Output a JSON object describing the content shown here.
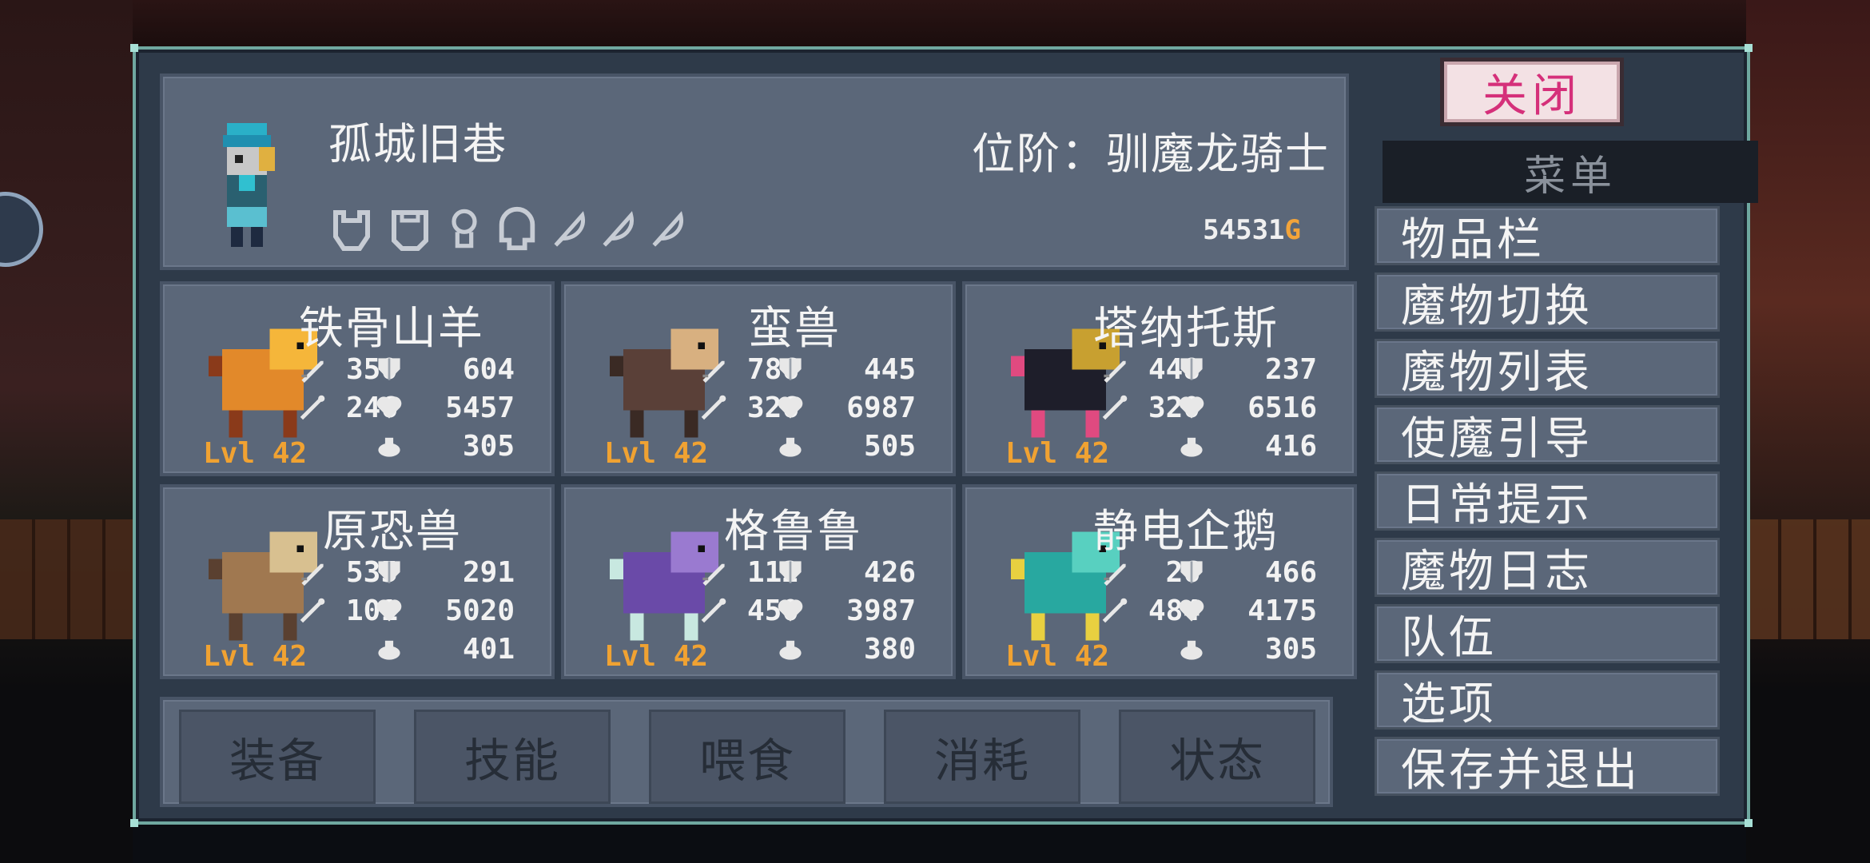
{
  "player": {
    "name": "孤城旧巷",
    "rank": "位阶：驯魔龙骑士",
    "gold_amount": "54531",
    "gold_unit": "G",
    "badges": [
      "badge-icon",
      "badge-icon",
      "badge-icon",
      "badge-icon",
      "feather-icon",
      "feather-icon",
      "feather-icon"
    ]
  },
  "monsters": [
    {
      "name": "铁骨山羊",
      "atk": "350",
      "def": "604",
      "matk": "246",
      "hp": "5457",
      "mp": "305",
      "level": "Lvl 42"
    },
    {
      "name": "蛮兽",
      "atk": "786",
      "def": "445",
      "matk": "326",
      "hp": "6987",
      "mp": "505",
      "level": "Lvl 42"
    },
    {
      "name": "塔纳托斯",
      "atk": "448",
      "def": "237",
      "matk": "320",
      "hp": "6516",
      "mp": "416",
      "level": "Lvl 42"
    },
    {
      "name": "原恐兽",
      "atk": "535",
      "def": "291",
      "matk": "101",
      "hp": "5020",
      "mp": "401",
      "level": "Lvl 42"
    },
    {
      "name": "格鲁鲁",
      "atk": "112",
      "def": "426",
      "matk": "450",
      "hp": "3987",
      "mp": "380",
      "level": "Lvl 42"
    },
    {
      "name": "静电企鹅",
      "atk": "26",
      "def": "466",
      "matk": "484",
      "hp": "4175",
      "mp": "305",
      "level": "Lvl 42"
    }
  ],
  "tabs": [
    "装备",
    "技能",
    "喂食",
    "消耗",
    "状态"
  ],
  "menu": {
    "close_label": "关闭",
    "title": "菜单",
    "items": [
      "物品栏",
      "魔物切换",
      "魔物列表",
      "使魔引导",
      "日常提示",
      "魔物日志",
      "队伍",
      "选项",
      "保存并退出"
    ]
  },
  "colors": {
    "panel_bg": "#2e3a49",
    "card_bg": "#5b6779",
    "accent_gold": "#f3a43a",
    "level_orange": "#f0a232",
    "close_text": "#d5307a"
  }
}
